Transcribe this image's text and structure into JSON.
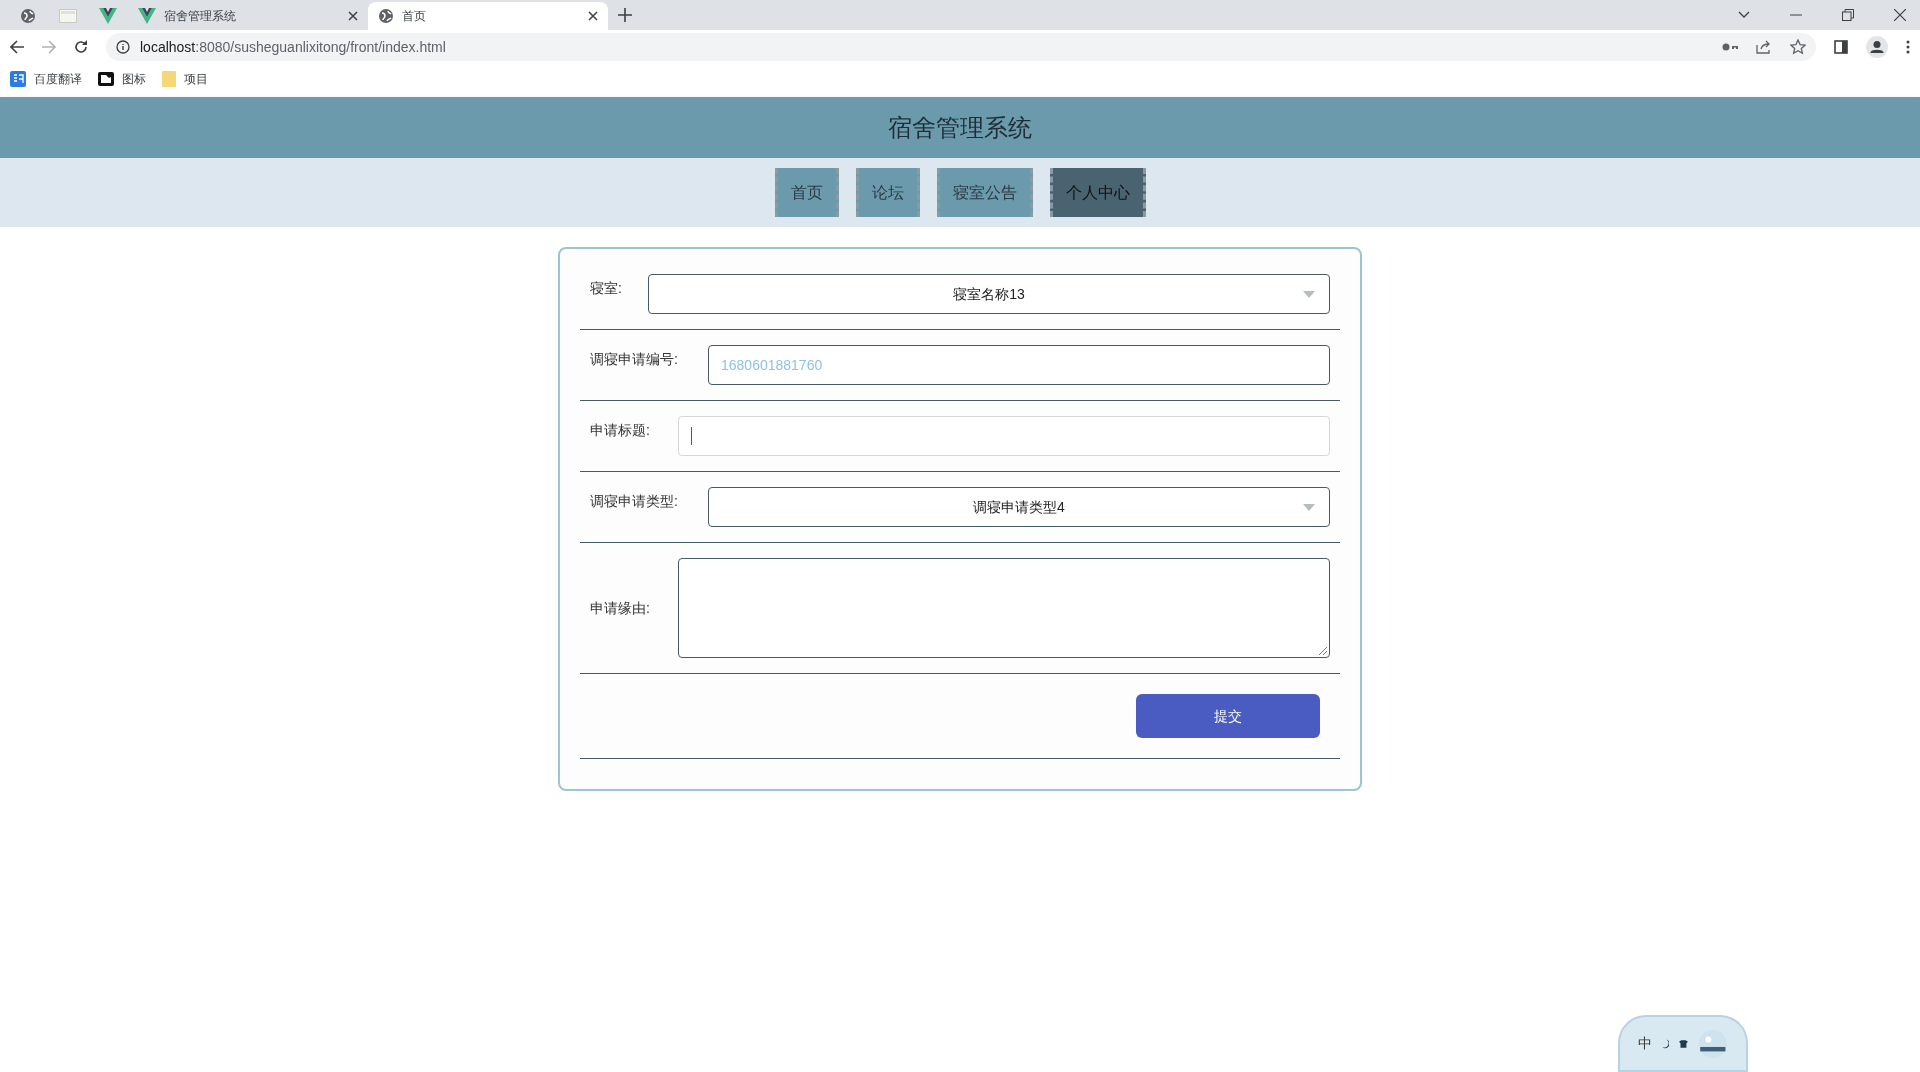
{
  "browser": {
    "tabs": [
      {
        "kind": "globe",
        "selected": false
      },
      {
        "kind": "page",
        "selected": false
      },
      {
        "kind": "vue",
        "selected": false
      },
      {
        "kind": "vue",
        "label": "宿舍管理系统",
        "closable": true,
        "selected": false
      },
      {
        "kind": "globe",
        "label": "首页",
        "closable": true,
        "selected": true
      }
    ],
    "address": {
      "host": "localhost",
      "path": ":8080/susheguanlixitong/front/index.html"
    },
    "bookmarks": [
      {
        "kind": "translate",
        "label": "百度翻译"
      },
      {
        "kind": "image",
        "label": "图标"
      },
      {
        "kind": "folder",
        "label": "项目"
      }
    ]
  },
  "site": {
    "title": "宿舍管理系统",
    "nav": [
      {
        "label": "首页",
        "selected": false
      },
      {
        "label": "论坛",
        "selected": false
      },
      {
        "label": "寝室公告",
        "selected": false
      },
      {
        "label": "个人中心",
        "selected": true
      }
    ],
    "form": {
      "fields": [
        {
          "kind": "select",
          "label": "寝室:",
          "value": "寝室名称13"
        },
        {
          "kind": "input",
          "label": "调寝申请编号:",
          "value": "1680601881760",
          "readonly": true,
          "focused": false
        },
        {
          "kind": "input",
          "label": "申请标题:",
          "readonly": false,
          "focused": true
        },
        {
          "kind": "select",
          "label": "调寝申请类型:",
          "value": "调寝申请类型4"
        },
        {
          "kind": "textarea",
          "label": "申请缘由:"
        }
      ],
      "submit": "提交"
    }
  },
  "ime": {
    "label": "中"
  }
}
